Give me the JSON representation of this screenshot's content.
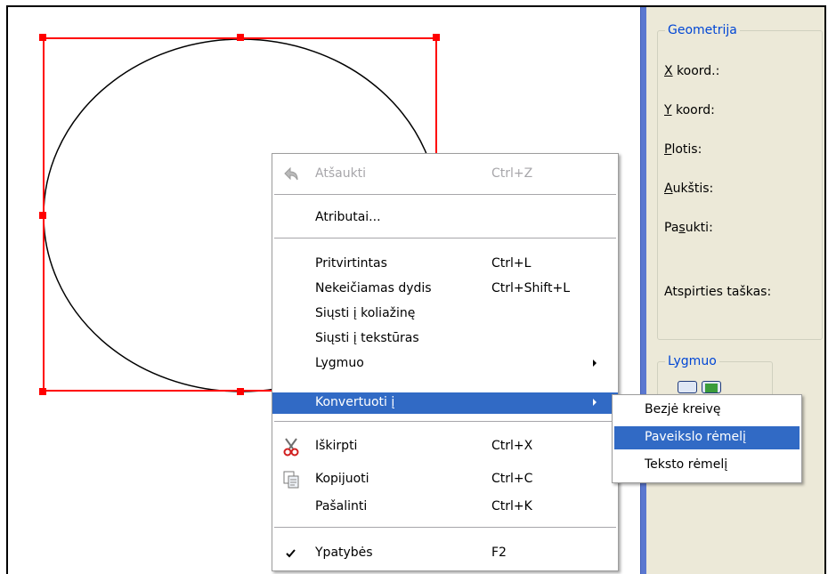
{
  "context_menu": {
    "items": [
      {
        "label": "Atšaukti",
        "shortcut": "Ctrl+Z",
        "icon": "undo-icon",
        "disabled": true
      },
      {
        "label": "Atributai...",
        "shortcut": ""
      },
      {
        "label": "Pritvirtintas",
        "shortcut": "Ctrl+L"
      },
      {
        "label": "Nekeičiamas dydis",
        "shortcut": "Ctrl+Shift+L"
      },
      {
        "label": "Siųsti į koliažinę",
        "shortcut": ""
      },
      {
        "label": "Siųsti į tekstūras",
        "shortcut": ""
      },
      {
        "label": "Lygmuo",
        "shortcut": "",
        "submenu": true
      },
      {
        "label": "Konvertuoti į",
        "shortcut": "",
        "submenu": true,
        "active": true
      },
      {
        "label": "Iškirpti",
        "shortcut": "Ctrl+X",
        "icon": "scissors-icon"
      },
      {
        "label": "Kopijuoti",
        "shortcut": "Ctrl+C",
        "icon": "copy-icon"
      },
      {
        "label": "Pašalinti",
        "shortcut": "Ctrl+K"
      },
      {
        "label": "Ypatybės",
        "shortcut": "F2",
        "icon": "checkmark-icon",
        "checked": true
      }
    ]
  },
  "submenu": {
    "items": [
      {
        "label": "Bezjė kreivę"
      },
      {
        "label": "Paveikslo rėmelį",
        "active": true
      },
      {
        "label": "Teksto rėmelį"
      }
    ]
  },
  "panel": {
    "geometry_group": "Geometrija",
    "x_first": "X",
    "x_rest": " koord.:",
    "y_first": "Y",
    "y_rest": " koord:",
    "width_first": "P",
    "width_rest": "lotis:",
    "height_first": "A",
    "height_rest": "ukštis:",
    "rotate_pre": "Pa",
    "rotate_ul": "s",
    "rotate_rest": "ukti:",
    "anchor_label": "Atspirties taškas:",
    "level_group": "Lygmuo"
  },
  "colors": {
    "selection": "#ff0000",
    "menu_highlight": "#316ac5",
    "panel_bg": "#ece9d8",
    "group_title": "#0046d5",
    "divider": "#5b78d0"
  }
}
